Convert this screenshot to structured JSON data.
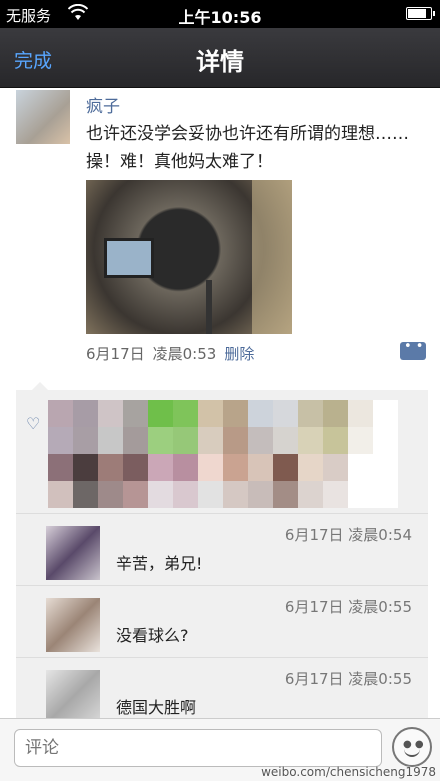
{
  "status_bar": {
    "carrier": "无服务",
    "time": "上午10:56",
    "battery_level": 0.9
  },
  "nav": {
    "back_label": "完成",
    "title": "详情"
  },
  "post": {
    "username": "疯子",
    "text": "也许还没学会妥协也许还有所谓的理想……操！难！真他妈太难了！",
    "date": "6月17日",
    "time": "凌晨0:53",
    "delete_label": "删除"
  },
  "comments": [
    {
      "time": "6月17日  凌晨0:54",
      "text": "辛苦，弟兄!"
    },
    {
      "time": "6月17日  凌晨0:55",
      "text": "没看球么?"
    },
    {
      "time": "6月17日  凌晨0:55",
      "text": "德国大胜啊"
    }
  ],
  "input": {
    "placeholder": "评论"
  },
  "watermark": "weibo.com/chensicheng1978"
}
